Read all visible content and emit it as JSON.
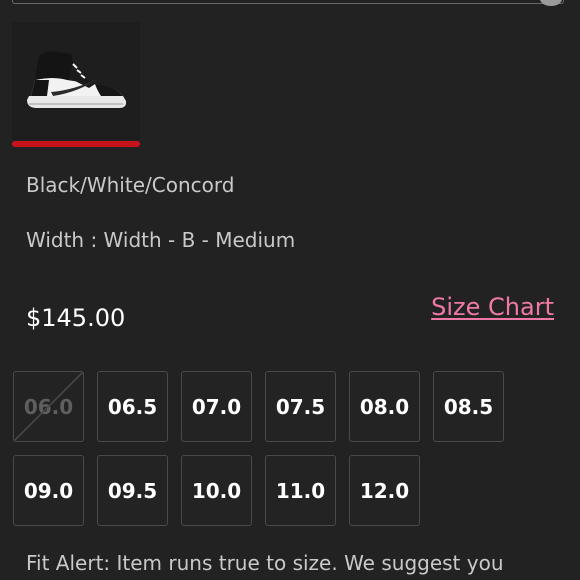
{
  "product": {
    "colorway": "Black/White/Concord",
    "width_text": "Width : Width - B - Medium",
    "price": "$145.00",
    "size_chart_label": "Size Chart"
  },
  "swatch": {
    "icon": "sneaker-thumbnail",
    "selected": true,
    "accent_color": "#c7141b"
  },
  "sizes": [
    {
      "label": "06.0",
      "available": false
    },
    {
      "label": "06.5",
      "available": true
    },
    {
      "label": "07.0",
      "available": true
    },
    {
      "label": "07.5",
      "available": true
    },
    {
      "label": "08.0",
      "available": true
    },
    {
      "label": "08.5",
      "available": true
    },
    {
      "label": "09.0",
      "available": true
    },
    {
      "label": "09.5",
      "available": true
    },
    {
      "label": "10.0",
      "available": true
    },
    {
      "label": "11.0",
      "available": true
    },
    {
      "label": "12.0",
      "available": true
    }
  ],
  "fit_alert": "Fit Alert: Item runs true to size. We suggest you",
  "colors": {
    "background": "#222222",
    "link": "#ef79a6",
    "accent": "#c7141b"
  }
}
